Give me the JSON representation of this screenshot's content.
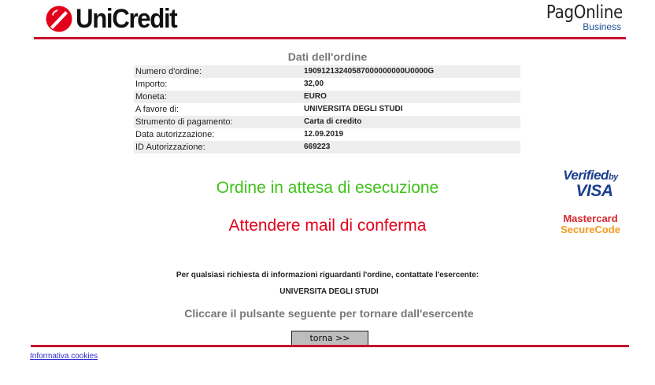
{
  "header": {
    "bank_logo_text": "UniCredit",
    "service_logo_text": "PagOnline",
    "service_logo_sub": "Business"
  },
  "order": {
    "title": "Dati dell'ordine",
    "rows": [
      {
        "label": "Numero d'ordine:",
        "value": "19091213240587000000000U0000G"
      },
      {
        "label": "Importo:",
        "value": "32,00"
      },
      {
        "label": "Moneta:",
        "value": "EURO"
      },
      {
        "label": "A favore di:",
        "value": "UNIVERSITA DEGLI STUDI"
      },
      {
        "label": "Strumento di pagamento:",
        "value": "Carta di credito"
      },
      {
        "label": "Data autorizzazione:",
        "value": "12.09.2019"
      },
      {
        "label": "ID Autorizzazione:",
        "value": "669223"
      }
    ]
  },
  "status": {
    "pending": "Ordine in attesa di esecuzione",
    "wait_mail": "Attendere mail di conferma"
  },
  "badges": {
    "visa_line1": "Verified",
    "visa_by": "by",
    "visa_line2": "VISA",
    "mc_line1": "Mastercard",
    "mc_line2": "SecureCode"
  },
  "contact": {
    "note": "Per qualsiasi richiesta di informazioni riguardanti l'ordine, contattate l'esercente:",
    "merchant": "UNIVERSITA DEGLI STUDI",
    "return_note": "Cliccare il pulsante seguente per tornare dall'esercente"
  },
  "actions": {
    "back_label": "torna >>"
  },
  "footer": {
    "cookies_link": "Informativa cookies"
  },
  "colors": {
    "brand_red": "#c8102e",
    "status_green": "#3fc21a",
    "status_red": "#e3001b",
    "visa_blue": "#1a3f8f"
  }
}
